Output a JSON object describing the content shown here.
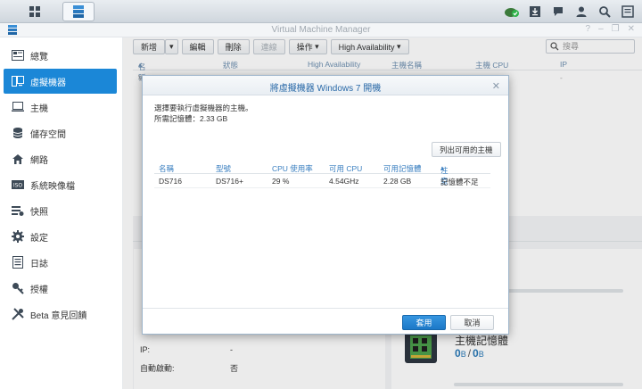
{
  "app": {
    "title": "Virtual Machine Manager"
  },
  "sidebar": {
    "items": [
      {
        "label": "總覽",
        "icon": "overview-icon"
      },
      {
        "label": "虛擬機器",
        "icon": "vm-icon",
        "active": true
      },
      {
        "label": "主機",
        "icon": "host-icon"
      },
      {
        "label": "儲存空間",
        "icon": "storage-icon"
      },
      {
        "label": "網路",
        "icon": "network-icon"
      },
      {
        "label": "系統映像檔",
        "icon": "image-icon"
      },
      {
        "label": "快照",
        "icon": "snapshot-icon"
      },
      {
        "label": "設定",
        "icon": "gear-icon"
      },
      {
        "label": "日誌",
        "icon": "log-icon"
      },
      {
        "label": "授權",
        "icon": "key-icon"
      },
      {
        "label": "Beta 意見回饋",
        "icon": "tools-icon"
      }
    ]
  },
  "toolbar": {
    "create": "新增",
    "edit": "編輯",
    "delete": "刪除",
    "connect": "連線",
    "action": "操作",
    "ha": "High Availability",
    "search_placeholder": "搜尋"
  },
  "grid": {
    "columns": [
      "名稱",
      "狀態",
      "High Availability",
      "主機名稱",
      "主機 CPU",
      "IP"
    ],
    "row": {
      "name": "W",
      "ip": "-"
    }
  },
  "details": {
    "ip_label": "IP:",
    "ip_value": "-",
    "autostart_label": "自動啟動:",
    "autostart_value": "否",
    "mem_title": "主機記憶體",
    "mem_used": "0",
    "mem_total": "0",
    "mem_unit": "B"
  },
  "modal": {
    "title": "將虛擬機器 Windows 7 開機",
    "instruction": "選擇要執行虛擬機器的主機。",
    "required_memory": "所需記憶體：2.33 GB",
    "list_button": "列出可用的主機",
    "columns": [
      "名稱",
      "型號",
      "CPU 使用率",
      "可用 CPU",
      "可用記憶體",
      "注意"
    ],
    "rows": [
      {
        "name": "DS716",
        "model": "DS716+",
        "cpu_usage": "29 %",
        "cpu_avail": "4.54GHz",
        "mem_avail": "2.28 GB",
        "note": "記憶體不足"
      }
    ],
    "ok": "套用",
    "cancel": "取消"
  },
  "colors": {
    "accent": "#1b87d7",
    "link": "#3a7fc0"
  }
}
